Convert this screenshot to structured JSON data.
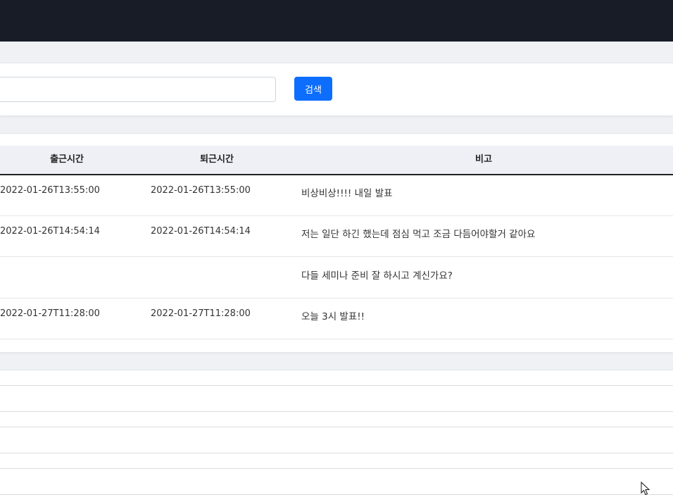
{
  "search": {
    "value": "",
    "placeholder": "",
    "button_label": "검색",
    "button_color": "#0d6efd"
  },
  "header": {
    "bar_color": "#181c27"
  },
  "table": {
    "columns": [
      "출근시간",
      "퇴근시간",
      "비고"
    ],
    "rows": [
      {
        "checkin": "2022-01-26T13:55:00",
        "checkout": "2022-01-26T13:55:00",
        "note": "비상비상!!!! 내일 발표"
      },
      {
        "checkin": "2022-01-26T14:54:14",
        "checkout": "2022-01-26T14:54:14",
        "note": "저는 일단 하긴 했는데 점심 먹고 조금 다듬어야할거 같아요"
      },
      {
        "checkin": "",
        "checkout": "",
        "note": "다들 세미나 준비 잘 하시고 계신가요?"
      },
      {
        "checkin": "2022-01-27T11:28:00",
        "checkout": "2022-01-27T11:28:00",
        "note": "오늘 3시 발표!!"
      }
    ]
  },
  "icons": {
    "cursor": "mouse-pointer-icon"
  }
}
